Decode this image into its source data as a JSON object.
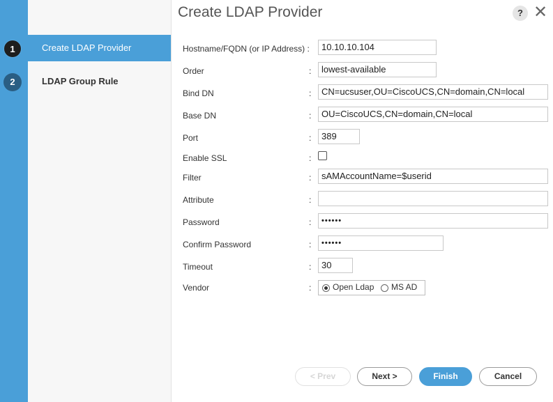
{
  "dialog": {
    "title": "Create LDAP Provider",
    "help_label": "?",
    "close_label": "✕"
  },
  "steps": [
    {
      "number": "1",
      "label": "Create LDAP Provider",
      "active": true
    },
    {
      "number": "2",
      "label": "LDAP Group Rule",
      "active": false
    }
  ],
  "form": {
    "colon": ":",
    "hostname": {
      "label": "Hostname/FQDN (or IP Address) :",
      "value": "10.10.10.104"
    },
    "order": {
      "label": "Order",
      "value": "lowest-available"
    },
    "bind_dn": {
      "label": "Bind DN",
      "value": "CN=ucsuser,OU=CiscoUCS,CN=domain,CN=local"
    },
    "base_dn": {
      "label": "Base DN",
      "value": "OU=CiscoUCS,CN=domain,CN=local"
    },
    "port": {
      "label": "Port",
      "value": "389"
    },
    "enable_ssl": {
      "label": "Enable SSL",
      "checked": false
    },
    "filter": {
      "label": "Filter",
      "value": "sAMAccountName=$userid"
    },
    "attribute": {
      "label": "Attribute",
      "value": ""
    },
    "password": {
      "label": "Password",
      "value": "••••••"
    },
    "confirm_password": {
      "label": "Confirm Password",
      "value": "••••••"
    },
    "timeout": {
      "label": "Timeout",
      "value": "30"
    },
    "vendor": {
      "label": "Vendor",
      "options": [
        "Open Ldap",
        "MS AD"
      ],
      "selected": "Open Ldap"
    }
  },
  "buttons": {
    "prev": "< Prev",
    "next": "Next >",
    "finish": "Finish",
    "cancel": "Cancel"
  },
  "colors": {
    "accent": "#4a9fd8",
    "step_active_bg": "#4a9fd8",
    "nav_bg": "#f7f7f7"
  }
}
